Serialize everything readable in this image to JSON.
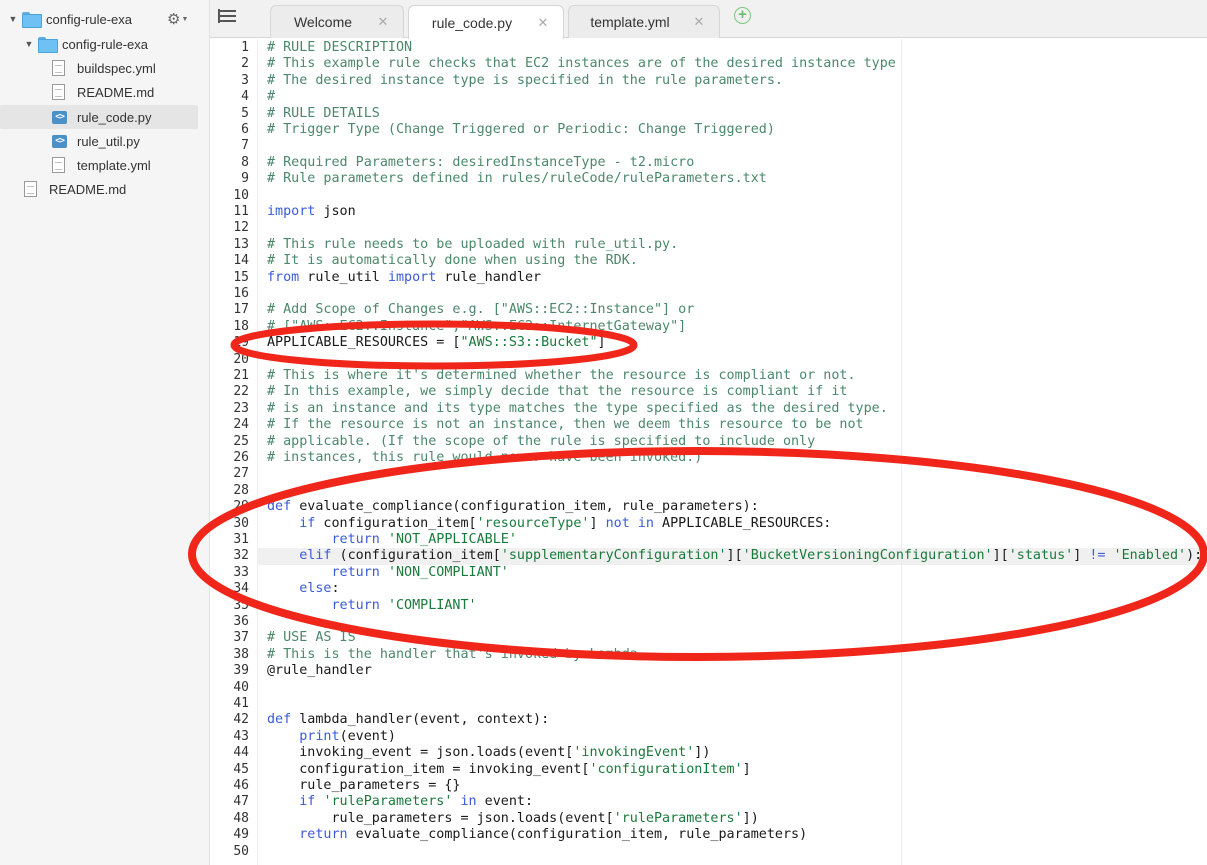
{
  "sidebar": {
    "tree": [
      {
        "label": "config-rule-exa",
        "kind": "folder",
        "expanded": true,
        "depth": 0
      },
      {
        "label": "config-rule-exa",
        "kind": "folder",
        "expanded": true,
        "depth": 1
      },
      {
        "label": "buildspec.yml",
        "kind": "file",
        "depth": 2
      },
      {
        "label": "README.md",
        "kind": "file",
        "depth": 2
      },
      {
        "label": "rule_code.py",
        "kind": "python",
        "depth": 2,
        "selected": true
      },
      {
        "label": "rule_util.py",
        "kind": "python",
        "depth": 2
      },
      {
        "label": "template.yml",
        "kind": "file",
        "depth": 2
      },
      {
        "label": "README.md",
        "kind": "file",
        "depth": 1
      }
    ]
  },
  "tabs": [
    {
      "label": "Welcome",
      "close": "✕",
      "active": false
    },
    {
      "label": "rule_code.py",
      "close": "✕",
      "active": true
    },
    {
      "label": "template.yml",
      "close": "✕",
      "active": false
    }
  ],
  "add_tab_symbol": "+",
  "editor": {
    "active_line": 32,
    "colors": {
      "comment": "#4c886b",
      "keyword": "#3b5bdb",
      "string": "#1a7a3c",
      "annotation": "#f0261b"
    },
    "lines": [
      [
        [
          "c",
          "# RULE DESCRIPTION"
        ]
      ],
      [
        [
          "c",
          "# This example rule checks that EC2 instances are of the desired instance type"
        ]
      ],
      [
        [
          "c",
          "# The desired instance type is specified in the rule parameters."
        ]
      ],
      [
        [
          "c",
          "#"
        ]
      ],
      [
        [
          "c",
          "# RULE DETAILS"
        ]
      ],
      [
        [
          "c",
          "# Trigger Type (Change Triggered or Periodic: Change Triggered)"
        ]
      ],
      [],
      [
        [
          "c",
          "# Required Parameters: desiredInstanceType - t2.micro"
        ]
      ],
      [
        [
          "c",
          "# Rule parameters defined in rules/ruleCode/ruleParameters.txt"
        ]
      ],
      [],
      [
        [
          "k",
          "import"
        ],
        [
          "p",
          " json"
        ]
      ],
      [],
      [
        [
          "c",
          "# This rule needs to be uploaded with rule_util.py."
        ]
      ],
      [
        [
          "c",
          "# It is automatically done when using the RDK."
        ]
      ],
      [
        [
          "k",
          "from"
        ],
        [
          "p",
          " rule_util "
        ],
        [
          "k",
          "import"
        ],
        [
          "p",
          " rule_handler"
        ]
      ],
      [],
      [
        [
          "c",
          "# Add Scope of Changes e.g. [\"AWS::EC2::Instance\"] or"
        ]
      ],
      [
        [
          "c",
          "# [\"AWS::EC2::Instance\",\"AWS::EC2::InternetGateway\"]"
        ]
      ],
      [
        [
          "p",
          "APPLICABLE_RESOURCES = ["
        ],
        [
          "s",
          "\"AWS::S3::Bucket\""
        ],
        [
          "p",
          "]"
        ]
      ],
      [],
      [
        [
          "c",
          "# This is where it's determined whether the resource is compliant or not."
        ]
      ],
      [
        [
          "c",
          "# In this example, we simply decide that the resource is compliant if it"
        ]
      ],
      [
        [
          "c",
          "# is an instance and its type matches the type specified as the desired type."
        ]
      ],
      [
        [
          "c",
          "# If the resource is not an instance, then we deem this resource to be not"
        ]
      ],
      [
        [
          "c",
          "# applicable. (If the scope of the rule is specified to include only"
        ]
      ],
      [
        [
          "c",
          "# instances, this rule would never have been invoked.)"
        ]
      ],
      [],
      [],
      [
        [
          "k",
          "def"
        ],
        [
          "p",
          " evaluate_compliance(configuration_item, rule_parameters):"
        ]
      ],
      [
        [
          "p",
          "    "
        ],
        [
          "k",
          "if"
        ],
        [
          "p",
          " configuration_item["
        ],
        [
          "s",
          "'resourceType'"
        ],
        [
          "p",
          "] "
        ],
        [
          "k",
          "not in"
        ],
        [
          "p",
          " APPLICABLE_RESOURCES:"
        ]
      ],
      [
        [
          "p",
          "        "
        ],
        [
          "k",
          "return"
        ],
        [
          "p",
          " "
        ],
        [
          "s",
          "'NOT_APPLICABLE'"
        ]
      ],
      [
        [
          "p",
          "    "
        ],
        [
          "k",
          "elif"
        ],
        [
          "p",
          " (configuration_item["
        ],
        [
          "s",
          "'supplementaryConfiguration'"
        ],
        [
          "p",
          "]["
        ],
        [
          "s",
          "'BucketVersioningConfiguration'"
        ],
        [
          "p",
          "]["
        ],
        [
          "s",
          "'status'"
        ],
        [
          "p",
          "] "
        ],
        [
          "k",
          "!="
        ],
        [
          "p",
          " "
        ],
        [
          "s",
          "'Enabled'"
        ],
        [
          "p",
          "):"
        ]
      ],
      [
        [
          "p",
          "        "
        ],
        [
          "k",
          "return"
        ],
        [
          "p",
          " "
        ],
        [
          "s",
          "'NON_COMPLIANT'"
        ]
      ],
      [
        [
          "p",
          "    "
        ],
        [
          "k",
          "else"
        ],
        [
          "p",
          ":"
        ]
      ],
      [
        [
          "p",
          "        "
        ],
        [
          "k",
          "return"
        ],
        [
          "p",
          " "
        ],
        [
          "s",
          "'COMPLIANT'"
        ]
      ],
      [],
      [
        [
          "c",
          "# USE AS IS"
        ]
      ],
      [
        [
          "c",
          "# This is the handler that's invoked by Lambda"
        ]
      ],
      [
        [
          "p",
          "@rule_handler"
        ]
      ],
      [],
      [],
      [
        [
          "k",
          "def"
        ],
        [
          "p",
          " lambda_handler(event, context):"
        ]
      ],
      [
        [
          "p",
          "    "
        ],
        [
          "k",
          "print"
        ],
        [
          "p",
          "(event)"
        ]
      ],
      [
        [
          "p",
          "    invoking_event = json.loads(event["
        ],
        [
          "s",
          "'invokingEvent'"
        ],
        [
          "p",
          "])"
        ]
      ],
      [
        [
          "p",
          "    configuration_item = invoking_event["
        ],
        [
          "s",
          "'configurationItem'"
        ],
        [
          "p",
          "]"
        ]
      ],
      [
        [
          "p",
          "    rule_parameters = {}"
        ]
      ],
      [
        [
          "p",
          "    "
        ],
        [
          "k",
          "if"
        ],
        [
          "p",
          " "
        ],
        [
          "s",
          "'ruleParameters'"
        ],
        [
          "p",
          " "
        ],
        [
          "k",
          "in"
        ],
        [
          "p",
          " event:"
        ]
      ],
      [
        [
          "p",
          "        rule_parameters = json.loads(event["
        ],
        [
          "s",
          "'ruleParameters'"
        ],
        [
          "p",
          "])"
        ]
      ],
      [
        [
          "p",
          "    "
        ],
        [
          "k",
          "return"
        ],
        [
          "p",
          " evaluate_compliance(configuration_item, rule_parameters)"
        ]
      ],
      []
    ]
  }
}
